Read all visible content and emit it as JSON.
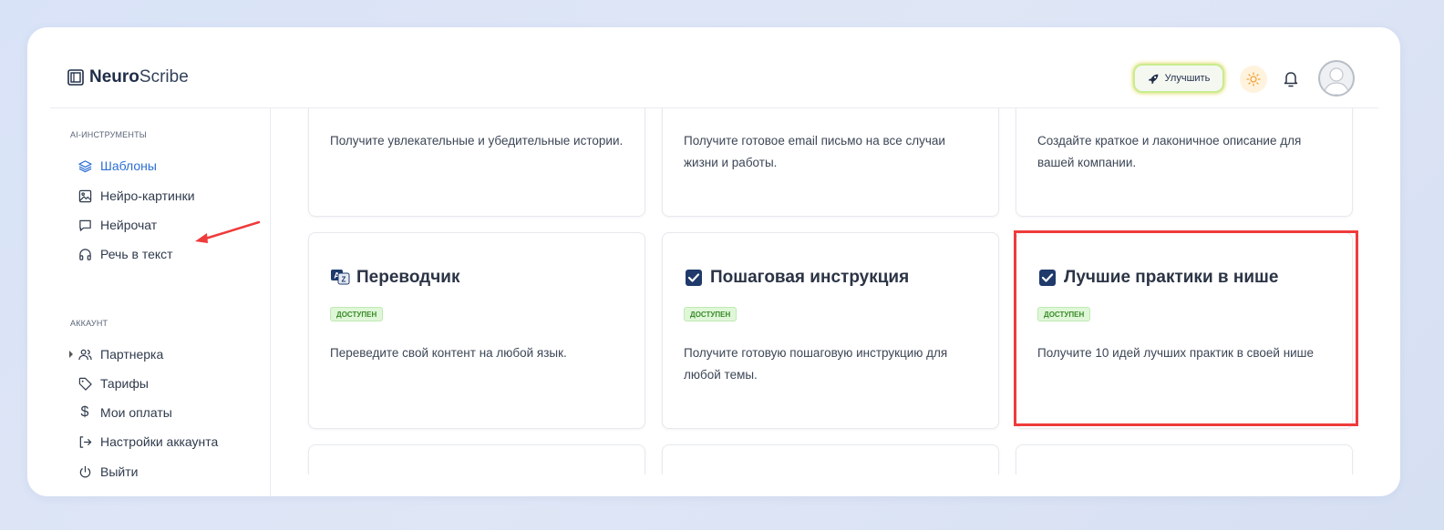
{
  "app": {
    "brand_bold": "Neuro",
    "brand_rest": "Scribe"
  },
  "header": {
    "upgrade_label": "Улучшить"
  },
  "sidebar": {
    "ai_section": "AI-ИНСТРУМЕНТЫ",
    "ai_items": [
      {
        "label": "Шаблоны",
        "icon": "layers-icon",
        "active": true
      },
      {
        "label": "Нейро-картинки",
        "icon": "image-icon"
      },
      {
        "label": "Нейрочат",
        "icon": "chat-icon"
      },
      {
        "label": "Речь в текст",
        "icon": "headphones-icon"
      }
    ],
    "account_section": "АККАУНТ",
    "account_items": [
      {
        "label": "Партнерка",
        "icon": "users-icon"
      },
      {
        "label": "Тарифы",
        "icon": "tag-icon"
      },
      {
        "label": "Мои оплаты",
        "icon": "dollar-icon"
      },
      {
        "label": "Настройки аккаунта",
        "icon": "login-icon"
      },
      {
        "label": "Выйти",
        "icon": "power-icon"
      }
    ]
  },
  "cards_top": [
    {
      "desc": "Получите увлекательные и убедительные истории."
    },
    {
      "desc": "Получите готовое email письмо на все случаи жизни и работы."
    },
    {
      "desc": "Создайте краткое и лаконичное описание для вашей компании."
    }
  ],
  "cards_mid": [
    {
      "title": "Переводчик",
      "badge": "ДОСТУПЕН",
      "desc": "Переведите свой контент на любой язык.",
      "icon": "translate-icon"
    },
    {
      "title": "Пошаговая инструкция",
      "badge": "ДОСТУПЕН",
      "desc": "Получите готовую пошаговую инструкцию для любой темы.",
      "icon": "checkbox-icon"
    },
    {
      "title": "Лучшие практики в нише",
      "badge": "ДОСТУПЕН",
      "desc": "Получите 10 идей лучших практик в своей нише",
      "icon": "checkbox-icon"
    }
  ],
  "colors": {
    "accent": "#2d6fd6",
    "highlight": "#ef3b3b",
    "badge_bg": "#dff7d8",
    "badge_text": "#3b8a2a"
  }
}
